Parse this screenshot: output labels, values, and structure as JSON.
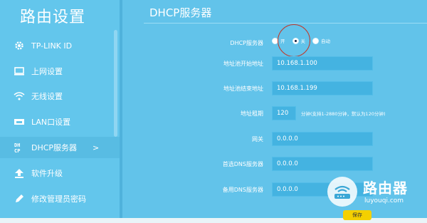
{
  "sidebar": {
    "title": "路由设置",
    "items": [
      {
        "label": "TP-LINK ID",
        "icon": "gear-icon"
      },
      {
        "label": "上网设置",
        "icon": "monitor-icon"
      },
      {
        "label": "无线设置",
        "icon": "wifi-icon"
      },
      {
        "label": "LAN口设置",
        "icon": "lan-icon"
      },
      {
        "label": "DHCP服务器",
        "icon": "dhcp-icon",
        "active": true,
        "chevron": ">"
      },
      {
        "label": "软件升级",
        "icon": "upgrade-icon"
      },
      {
        "label": "修改管理员密码",
        "icon": "pencil-icon"
      }
    ]
  },
  "main": {
    "title": "DHCP服务器",
    "dhcp_label": "DHCP服务器",
    "radio_options": [
      {
        "label": "开",
        "checked": false
      },
      {
        "label": "关",
        "checked": true
      },
      {
        "label": "自动",
        "checked": false
      }
    ],
    "pool_start_label": "地址池开始地址",
    "pool_start_value": "10.168.1.100",
    "pool_end_label": "地址池结束地址",
    "pool_end_value": "10.168.1.199",
    "lease_label": "地址租期",
    "lease_value": "120",
    "lease_hint": "分钟(支持1-2880分钟，默认为120分钟)",
    "gateway_label": "网关",
    "gateway_value": "0.0.0.0",
    "dns1_label": "首选DNS服务器",
    "dns1_value": "0.0.0.0",
    "dns2_label": "备用DNS服务器",
    "dns2_value": "0.0.0.0",
    "save_label": "保存"
  },
  "watermark": {
    "title": "路由器",
    "url": "luyouqi.com"
  },
  "colors": {
    "background": "#62c3ea",
    "input": "#44b3e1",
    "save_button": "#f4d000",
    "annotation": "#c0392b"
  }
}
